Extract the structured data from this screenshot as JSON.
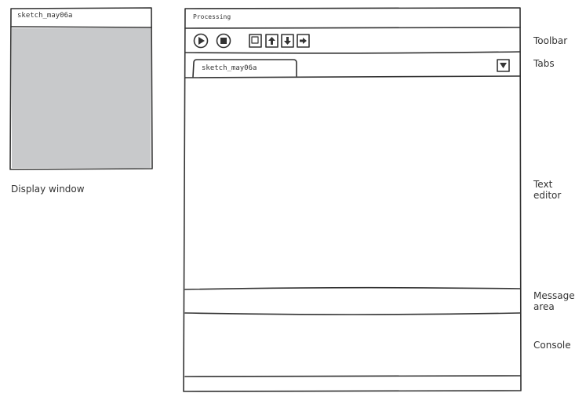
{
  "display_window": {
    "title": "sketch_may06a",
    "caption": "Display window",
    "canvas_color": "#c8c9cb"
  },
  "pde_window": {
    "title": "Processing",
    "toolbar": {
      "buttons": [
        "run-icon",
        "stop-icon",
        "new-icon",
        "open-icon",
        "save-icon",
        "export-icon"
      ]
    },
    "tab": {
      "label": "sketch_may06a"
    }
  },
  "labels": {
    "toolbar": "Toolbar",
    "tabs": "Tabs",
    "text_editor": "Text editor",
    "message_area": "Message area",
    "console": "Console"
  }
}
